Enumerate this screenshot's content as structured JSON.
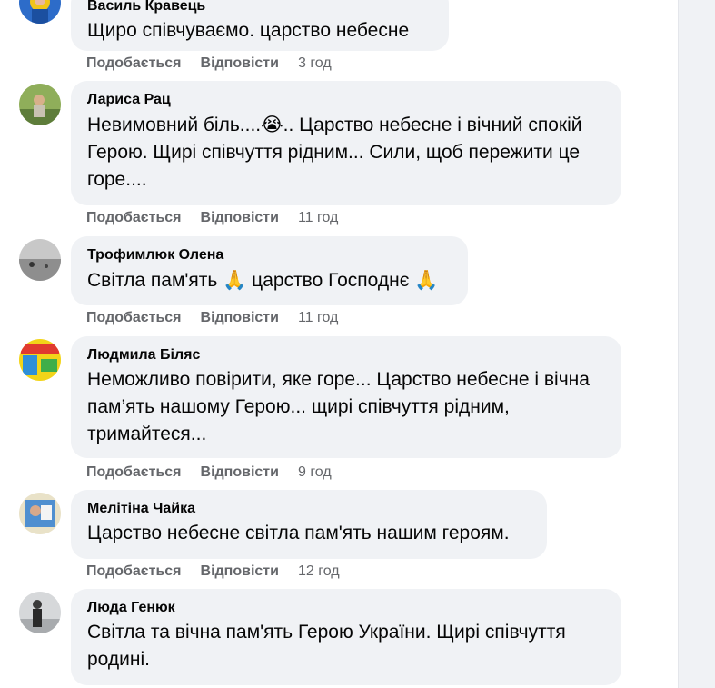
{
  "actions": {
    "like_label": "Подобається",
    "reply_label": "Відповісти"
  },
  "colors": {
    "bubble": "#f0f2f5",
    "meta_text": "#65676b",
    "main_text": "#050505"
  },
  "comments": [
    {
      "author": "Василь Кравець",
      "text": "Щиро співчуваємо. царство небесне",
      "time": "3 год"
    },
    {
      "author": "Лариса Рац",
      "text_before": "Невимовний біль....",
      "emoji": "😭",
      "text_after": ".. Царство небесне і вічний спокій Герою. Щирі співчуття рідним... Сили, щоб пережити це горе....",
      "time": "11 год"
    },
    {
      "author": "Трофимлюк Олена",
      "text_1": "Світла пам'ять ",
      "emoji_1": "🙏",
      "text_2": " царство Господнє ",
      "emoji_2": "🙏",
      "time": "11 год"
    },
    {
      "author": "Людмила Біляс",
      "text": "Неможливо повірити, яке горе... Царство небесне і вічна пам’ять нашому Герою... щирі співчуття рідним, тримайтеся...",
      "time": "9 год"
    },
    {
      "author": "Мелітіна Чайка",
      "text": "Царство небесне світла пам'ять нашим героям.",
      "time": "12 год"
    },
    {
      "author": "Люда Генюк",
      "text": "Світла та вічна пам'ять Герою України. Щирі співчуття родині."
    }
  ]
}
